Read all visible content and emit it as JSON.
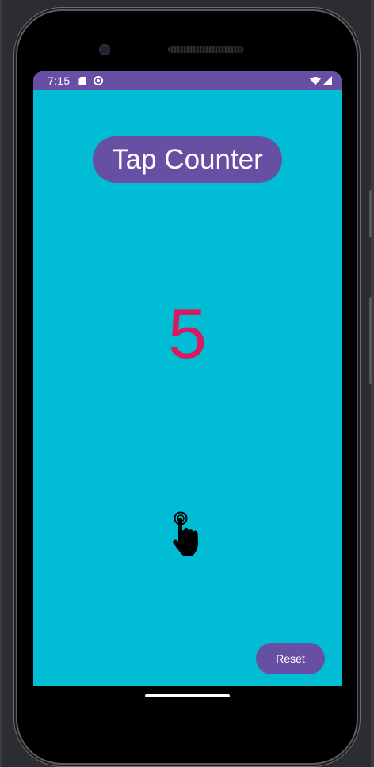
{
  "status_bar": {
    "time": "7:15",
    "icons": [
      "sd-card-icon",
      "sync-circle-icon",
      "wifi-icon",
      "signal-icon"
    ]
  },
  "app": {
    "title": "Tap Counter",
    "count": "5",
    "reset_label": "Reset",
    "tap_icon": "tap-hand-icon"
  },
  "colors": {
    "background": "#00bcd4",
    "primary": "#6750a4",
    "counter": "#d81b60"
  }
}
